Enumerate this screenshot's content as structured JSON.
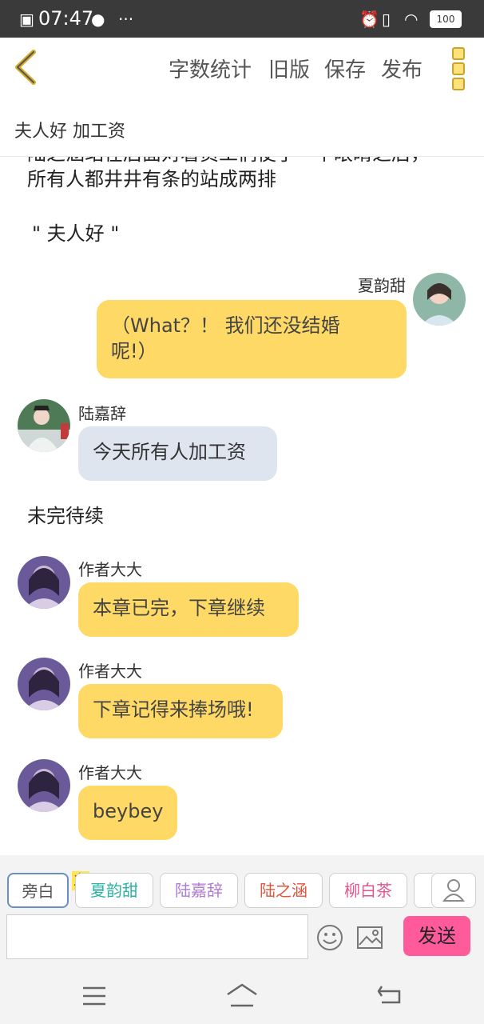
{
  "status": {
    "time": "07:47",
    "battery": "100"
  },
  "appbar": {
    "word_count": "字数统计",
    "old_version": "旧版",
    "save": "保存",
    "publish": "发布"
  },
  "chapter": {
    "title": "夫人好  加工资"
  },
  "content": {
    "para_top_partial": "陆之涵站在后面对着员工们使了一个眼睛之后，",
    "para_line2": "所有人都井井有条的站成两排",
    "quote": "\" 夫人好 \"",
    "messages": [
      {
        "name": "夏韵甜",
        "text_line1": "（What？！ 我们还没结婚",
        "text_line2": "呢!）"
      },
      {
        "name": "陆嘉辞",
        "text": "今天所有人加工资"
      },
      {
        "narration": "未完待续"
      },
      {
        "name": "作者大大",
        "text": "本章已完，下章继续"
      },
      {
        "name": "作者大大",
        "text": "下章记得来捧场哦!"
      },
      {
        "name": "作者大大",
        "text": "beybey"
      }
    ]
  },
  "roles": {
    "narrator": "旁白",
    "main_badge": "主",
    "r1": "夏韵甜",
    "r2": "陆嘉辞",
    "r3": "陆之涵",
    "r4": "柳白茶"
  },
  "composer": {
    "send": "发送",
    "placeholder": ""
  },
  "colors": {
    "accent_yellow": "#ffd966",
    "send_pink": "#ff5b9a"
  }
}
